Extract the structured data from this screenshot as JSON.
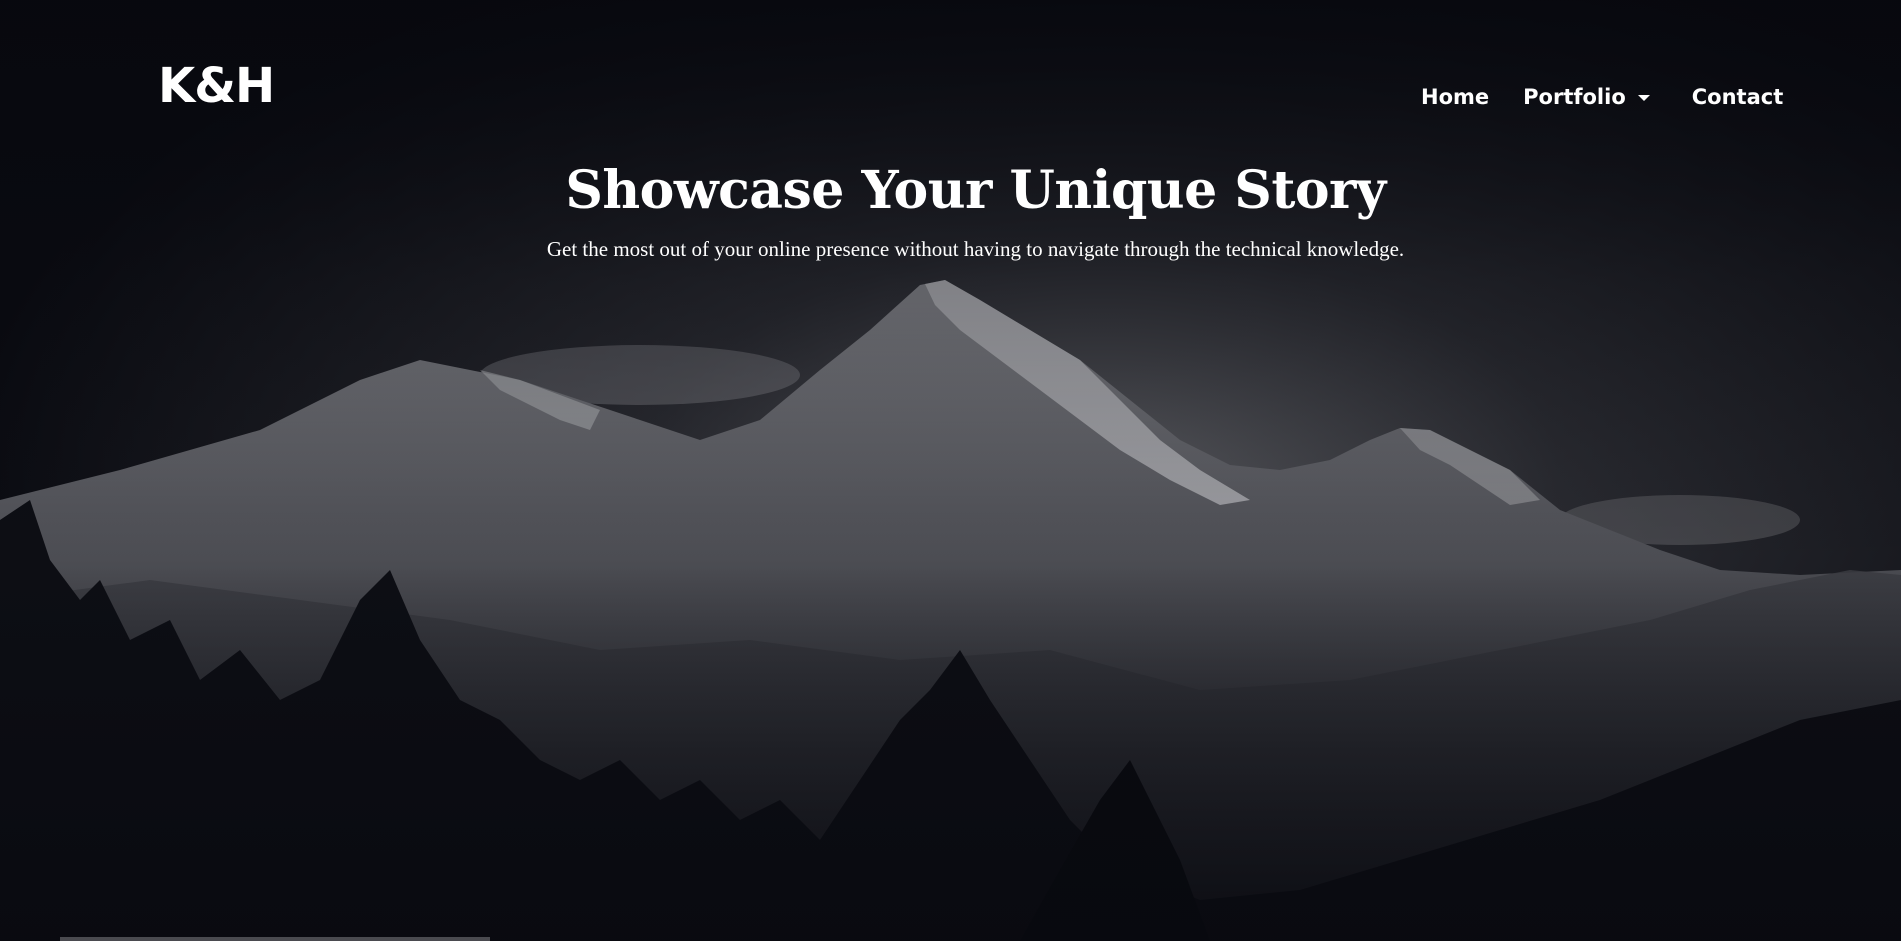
{
  "navbar": {
    "brand": "K&H",
    "links": {
      "home": "Home",
      "portfolio": "Portfolio",
      "contact": "Contact"
    }
  },
  "hero": {
    "title": "Showcase Your Unique Story",
    "subtitle": "Get the most out of your online presence without having to navigate through the technical knowledge."
  },
  "colors": {
    "text": "#ffffff",
    "background": "#0b0c12"
  },
  "icons": {
    "portfolio_dropdown": "caret-down-icon"
  }
}
